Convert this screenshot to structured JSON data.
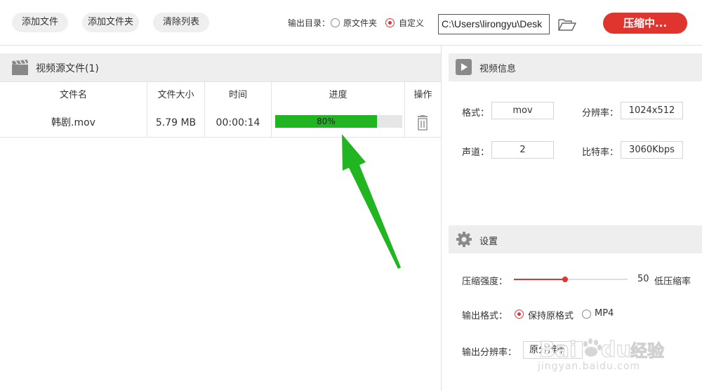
{
  "toolbar": {
    "add_file": "添加文件",
    "add_folder": "添加文件夹",
    "clear_list": "清除列表",
    "output_dir_label": "输出目录：",
    "option_source_folder": "原文件夹",
    "option_custom": "自定义",
    "selected_output": "自定义",
    "output_path": "C:\\Users\\lirongyu\\Desk",
    "folder_icon": "folder-open-icon",
    "compress_button": "压缩中..."
  },
  "source_panel": {
    "icon": "video-clapper-icon",
    "title": "视频源文件(1)",
    "columns": [
      "文件名",
      "文件大小",
      "时间",
      "进度",
      "操作"
    ],
    "rows": [
      {
        "name": "韩剧.mov",
        "size": "5.79 MB",
        "time": "00:00:14",
        "progress": 0.8,
        "progress_label": "80%",
        "action_icon": "trash-icon"
      }
    ]
  },
  "video_info": {
    "icon": "play-icon",
    "title": "视频信息",
    "format_label": "格式：",
    "format_value": "mov",
    "resolution_label": "分辨率：",
    "resolution_value": "1024x512",
    "channel_label": "声道：",
    "channel_value": "2",
    "bitrate_label": "比特率：",
    "bitrate_value": "3060Kbps"
  },
  "settings": {
    "icon": "gear-icon",
    "title": "设置",
    "strength_label": "压缩强度：",
    "strength_value": "50",
    "strength_hint": "低压缩率",
    "strength_fraction": 0.45,
    "format_label": "输出格式：",
    "format_keep": "保持原格式",
    "format_mp4": "MP4",
    "format_selected": "保持原格式",
    "resolution_label": "输出分辨率：",
    "resolution_value": "原分辨率"
  },
  "watermark": {
    "brand": "Baidu经验",
    "url": "jingyan.baidu.com"
  },
  "colors": {
    "accent": "#e0342f",
    "progress": "#22b522",
    "arrow": "#22b522",
    "section_bg": "#eeeeee"
  }
}
